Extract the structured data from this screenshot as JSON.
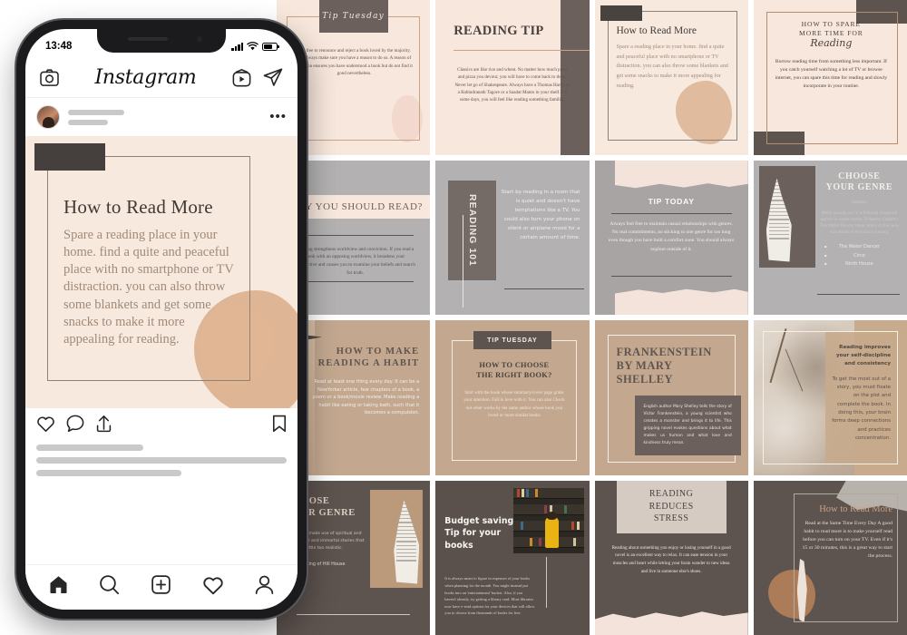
{
  "phone": {
    "status": {
      "time": "13:48",
      "signal_icon": "signal-bars-icon",
      "wifi_icon": "wifi-icon",
      "battery_icon": "battery-icon"
    },
    "app": {
      "title": "Instagram",
      "header_icons": {
        "camera": "camera-icon",
        "igtv": "igtv-icon",
        "direct": "paper-plane-icon"
      },
      "post": {
        "menu_icon": "more-options-icon",
        "image": {
          "heading": "How to Read More",
          "body": "Spare a reading place in your home. find a quite and peaceful place with no smartphone or TV distraction. you can also throw some blankets and get some snacks to make it more appealing for reading."
        },
        "actions": {
          "like": "heart-icon",
          "comment": "comment-icon",
          "share": "share-icon",
          "save": "bookmark-icon"
        }
      },
      "tabbar": [
        {
          "name": "home-icon",
          "label": "Home"
        },
        {
          "name": "search-icon",
          "label": "Search"
        },
        {
          "name": "add-post-icon",
          "label": "Add"
        },
        {
          "name": "activity-heart-icon",
          "label": "Activity"
        },
        {
          "name": "profile-icon",
          "label": "Profile"
        }
      ]
    }
  },
  "grid": {
    "cards": [
      {
        "id": "tip-tuesday",
        "tag": "Tip Tuesday",
        "body": "feel free to renounce and reject a book loved by the majority, but always make sure you have a reason to do so. A reason of rejection ensures you have understood a book but do not find it good nevertheless."
      },
      {
        "id": "reading-tip",
        "heading": "READING TIP",
        "body": "Classics are like rice and wheat. No matter how much pasta and pizza you devour, you will have to come back to them. Never let go of Shakespeare. Always have a Thomas Hardy or a Rabindranath Tagore or a Saadat Manto in your shelf. On some days, you will feel like reading something familiar."
      },
      {
        "id": "how-to-read-more",
        "heading": "How to Read More",
        "body": "Spare a reading place in your home. find a quite and peaceful place with no smartphone or TV distraction. you can also throw some blankets and get some snacks to make it more appealing for reading."
      },
      {
        "id": "how-to-spare-time",
        "heading_line1": "HOW TO SPARE",
        "heading_line2": "MORE TIME FOR",
        "heading_script": "Reading",
        "body": "Borrow reading time from something less important. If you catch yourself watching a lot of TV or browse internet, you can spare this time for reading and slowly incorporate in your routine."
      },
      {
        "id": "why-you-should-read",
        "heading": "WHY YOU SHOULD READ?",
        "body": "Reading strengthens worldview and conviction. If you read a book with an opposing worldview, it broadens your perspective and causes you to examine your beliefs and search for truth."
      },
      {
        "id": "reading-101",
        "vertical_label": "READING 101",
        "body": "Start by reading in a room that is quiet and doesn't have temptations like a TV. You could also turn your phone on silent or airplane mood for a certain amount of time."
      },
      {
        "id": "tip-today",
        "heading": "TIP TODAY",
        "body": "Always feel free to maintain casual relationships with genres. No real commitments, no sticking to one genre for too long even though you have built a comfort zone. You should always explore outside of it."
      },
      {
        "id": "choose-your-genre",
        "heading_line1": "CHOOSE",
        "heading_line2": "YOUR GENRE",
        "subheading": "Fantasy",
        "body": "While usually set in a fictional imagined world—in some cases, Ta-Nehisi Coates's The Water Dancer takes place in the very real world of America's slavery.",
        "list": [
          "The Water Dancer",
          "Circe",
          "Ninth House"
        ]
      },
      {
        "id": "reading-habit",
        "heading_line1": "HOW TO MAKE",
        "heading_line2": "READING A HABIT",
        "body": "Read at least one thing every day. It can be a NewYorker article, few chapters of a book, a poem or a book/movie review. Make reading a habit like eating or taking bath, such that it becomes a compulsion."
      },
      {
        "id": "choose-right-book",
        "tag": "TIP TUESDAY",
        "heading_line1": "HOW TO CHOOSE",
        "heading_line2": "THE RIGHT BOOK?",
        "body": "Start with the book whose summary/cover page grabs your attention. Fall in love with it. You can also Check out other works by the same author whose book you loved or more similar books"
      },
      {
        "id": "frankenstein",
        "heading_line1": "FRANKENSTEIN",
        "heading_line2": "BY MARY",
        "heading_line3": "SHELLEY",
        "body": "English author Mary Shelley tells the story of Victor Frankenstein, a young scientist who creates a monster and brings it to life. This gripping novel evokes questions about what makes us human and what love and kindness truly mean."
      },
      {
        "id": "reading-improves-discipline",
        "heading": "Reading improves your self-discipline and consistency",
        "body": "To get the most out of a story, you must fixate on the plot and complete the book. In doing this, your brain forms deep connections and practices concentration."
      },
      {
        "id": "choose-genre-dark",
        "heading_line1": "CHOOSE",
        "heading_line2": "YOUR GENRE",
        "body": "uses often make use of spiritual and paranormal and immortal stories that are just a little too realistic.",
        "item": "The Haunting of Hill House"
      },
      {
        "id": "budget-saving",
        "heading": "Budget saving Tip for your books",
        "body": "It is always smart to figure in expenses of your books when planning for the month. You might instead put books into an 'entertainment' bucket. Also, if you haven't already, try getting a library card. Most libraries now have e-read options for your devices that will allow you to choose from thousands of books for free."
      },
      {
        "id": "reading-reduces-stress",
        "heading_line1": "READING",
        "heading_line2": "REDUCES",
        "heading_line3": "STRESS",
        "body": "Reading about something you enjoy or losing yourself in a good novel is an excellent way to relax. It can ease tension in your muscles and heart while letting your brain wander to new ideas and live in someone else's shoes."
      },
      {
        "id": "read-same-time",
        "heading": "How to Read More",
        "body": "Read at the Same Time Every Day A good habit to read more is to make yourself read before you can turn on your TV. Even if it's 15 or 30 minutes, this is a great way to start the process."
      }
    ]
  },
  "colors": {
    "cream": "#f7e7dc",
    "taupe": "#c3a88f",
    "dark_brown": "#5d534f",
    "grey": "#b3b1b1",
    "accent_gold": "#c9a384"
  }
}
